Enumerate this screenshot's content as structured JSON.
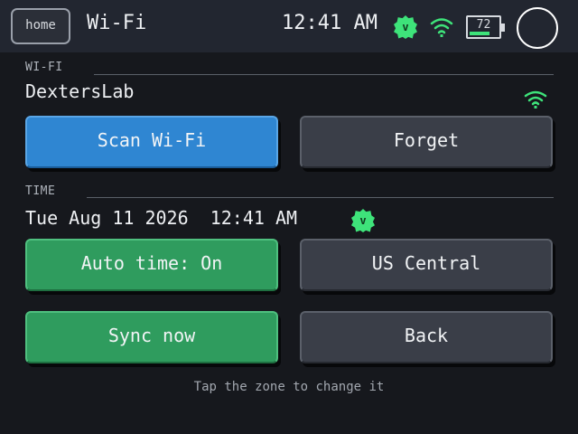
{
  "header": {
    "home_label": "home",
    "title": "Wi-Fi",
    "clock": "12:41 AM",
    "badge_letter": "v",
    "battery_percent": "72",
    "battery_level": 0.72
  },
  "wifi": {
    "section_label": "WI-FI",
    "ssid": "DextersLab",
    "scan_label": "Scan Wi-Fi",
    "forget_label": "Forget"
  },
  "time": {
    "section_label": "TIME",
    "datetime": "Tue Aug 11 2026  12:41 AM",
    "badge_letter": "v",
    "auto_time_label": "Auto time: On",
    "zone_label": "US Central",
    "sync_label": "Sync now",
    "back_label": "Back"
  },
  "hint": "Tap the zone to change it",
  "colors": {
    "background": "#16181d",
    "header": "#222630",
    "accent_blue": "#2f86d2",
    "accent_green": "#2f9c5e",
    "button_gray": "#3a3e48",
    "signal_green": "#3ee37a"
  },
  "icons": {
    "signal": "wifi-signal-icon",
    "battery": "battery-icon",
    "badge": "verified-badge-icon",
    "avatar": "circle-avatar-icon"
  }
}
